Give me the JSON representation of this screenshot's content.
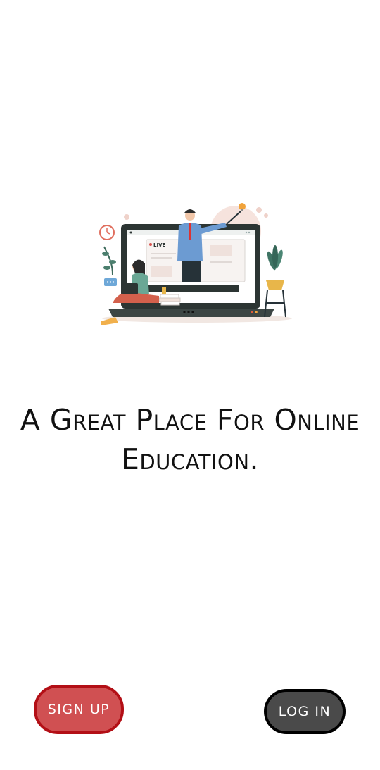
{
  "headline": {
    "line1": "A Great Place For Online",
    "line2": "Education."
  },
  "illustration": {
    "live_badge": "LIVE",
    "icon": "online-class-illustration"
  },
  "buttons": {
    "signup_label": "SIGN UP",
    "login_label": "LOG IN"
  },
  "colors": {
    "signup_fill": "#d05052",
    "signup_border": "#b30f16",
    "login_fill": "#4a4a4a",
    "login_border": "#000000"
  }
}
